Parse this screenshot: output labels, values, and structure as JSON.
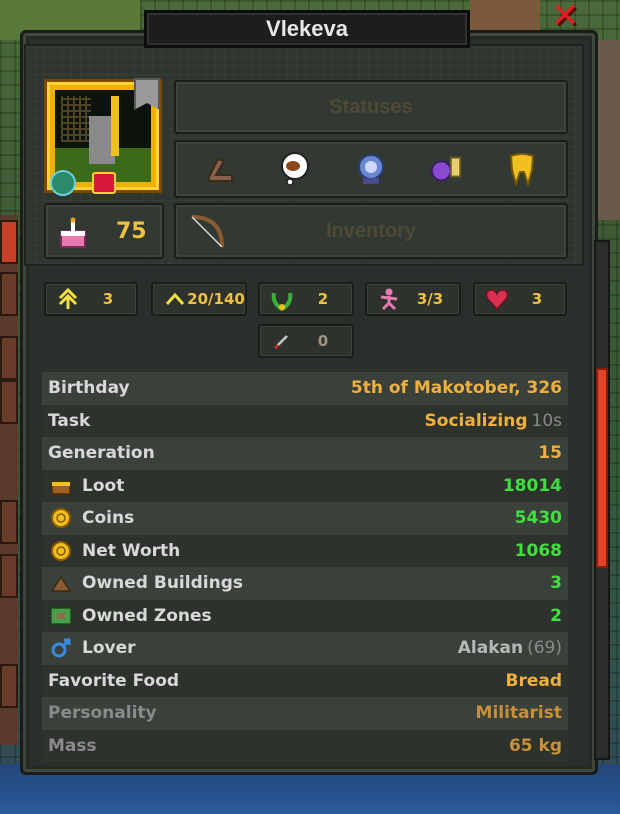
{
  "window": {
    "title": "Vlekeva",
    "close_icon": "close-x-icon"
  },
  "panels": {
    "statuses_label": "Statuses",
    "inventory_label": "Inventory",
    "age": "75"
  },
  "status_icons": [
    "bone-club-icon",
    "meat-thought-icon",
    "crystal-ball-ghost-icon",
    "purple-orb-icon",
    "golden-tooth-icon"
  ],
  "chips": [
    {
      "icon": "level-arrows-icon",
      "value": "3"
    },
    {
      "icon": "experience-arrow-icon",
      "value": "20/140"
    },
    {
      "icon": "laurel-wreath-icon",
      "value": "2"
    },
    {
      "icon": "dancing-figure-icon",
      "value": "3/3"
    },
    {
      "icon": "heart-skull-icon",
      "value": "3"
    },
    {
      "icon": "dagger-icon",
      "value": "0"
    }
  ],
  "info": [
    {
      "label": "Birthday",
      "value": "5th of Makotober, 326",
      "color": "orange"
    },
    {
      "label": "Task",
      "value": "Socializing",
      "sub": "10s",
      "color": "orange"
    },
    {
      "label": "Generation",
      "value": "15",
      "color": "orange"
    },
    {
      "label": "Loot",
      "icon": "treasure-chest-icon",
      "value": "18014",
      "color": "green"
    },
    {
      "label": "Coins",
      "icon": "coin-icon",
      "value": "5430",
      "color": "green"
    },
    {
      "label": "Net Worth",
      "icon": "coin-stack-icon",
      "value": "1068",
      "color": "green"
    },
    {
      "label": "Owned Buildings",
      "icon": "hut-icon",
      "value": "3",
      "color": "green"
    },
    {
      "label": "Owned Zones",
      "icon": "zone-map-icon",
      "value": "2",
      "color": "green"
    },
    {
      "label": "Lover",
      "icon": "male-symbol-icon",
      "value": "Alakan",
      "sub": "(69)",
      "color": "grey"
    },
    {
      "label": "Favorite Food",
      "value": "Bread",
      "color": "orange"
    },
    {
      "label": "Personality",
      "value": "Militarist",
      "color": "orange"
    },
    {
      "label": "Mass",
      "value": "65 kg",
      "color": "orange"
    }
  ],
  "colors": {
    "accent_gold": "#f0c040",
    "value_green": "#3ee03e",
    "close_red": "#e02020"
  }
}
